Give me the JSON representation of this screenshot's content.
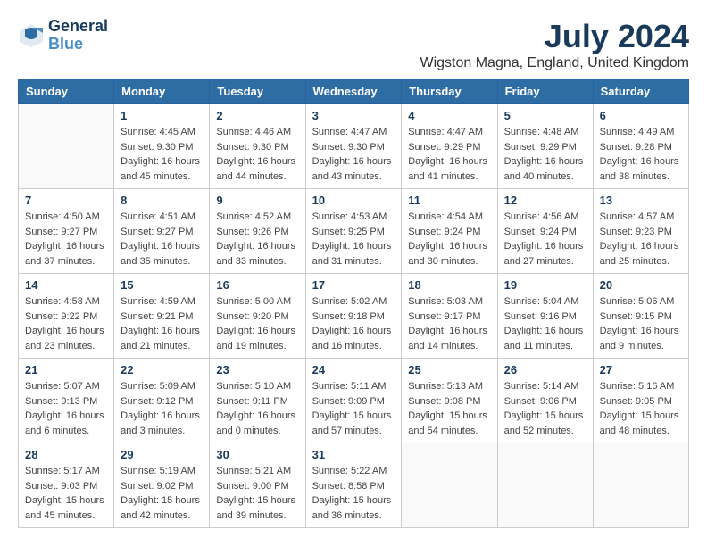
{
  "logo": {
    "line1": "General",
    "line2": "Blue"
  },
  "title": "July 2024",
  "location": "Wigston Magna, England, United Kingdom",
  "weekdays": [
    "Sunday",
    "Monday",
    "Tuesday",
    "Wednesday",
    "Thursday",
    "Friday",
    "Saturday"
  ],
  "weeks": [
    [
      {
        "day": "",
        "info": ""
      },
      {
        "day": "1",
        "info": "Sunrise: 4:45 AM\nSunset: 9:30 PM\nDaylight: 16 hours\nand 45 minutes."
      },
      {
        "day": "2",
        "info": "Sunrise: 4:46 AM\nSunset: 9:30 PM\nDaylight: 16 hours\nand 44 minutes."
      },
      {
        "day": "3",
        "info": "Sunrise: 4:47 AM\nSunset: 9:30 PM\nDaylight: 16 hours\nand 43 minutes."
      },
      {
        "day": "4",
        "info": "Sunrise: 4:47 AM\nSunset: 9:29 PM\nDaylight: 16 hours\nand 41 minutes."
      },
      {
        "day": "5",
        "info": "Sunrise: 4:48 AM\nSunset: 9:29 PM\nDaylight: 16 hours\nand 40 minutes."
      },
      {
        "day": "6",
        "info": "Sunrise: 4:49 AM\nSunset: 9:28 PM\nDaylight: 16 hours\nand 38 minutes."
      }
    ],
    [
      {
        "day": "7",
        "info": "Sunrise: 4:50 AM\nSunset: 9:27 PM\nDaylight: 16 hours\nand 37 minutes."
      },
      {
        "day": "8",
        "info": "Sunrise: 4:51 AM\nSunset: 9:27 PM\nDaylight: 16 hours\nand 35 minutes."
      },
      {
        "day": "9",
        "info": "Sunrise: 4:52 AM\nSunset: 9:26 PM\nDaylight: 16 hours\nand 33 minutes."
      },
      {
        "day": "10",
        "info": "Sunrise: 4:53 AM\nSunset: 9:25 PM\nDaylight: 16 hours\nand 31 minutes."
      },
      {
        "day": "11",
        "info": "Sunrise: 4:54 AM\nSunset: 9:24 PM\nDaylight: 16 hours\nand 30 minutes."
      },
      {
        "day": "12",
        "info": "Sunrise: 4:56 AM\nSunset: 9:24 PM\nDaylight: 16 hours\nand 27 minutes."
      },
      {
        "day": "13",
        "info": "Sunrise: 4:57 AM\nSunset: 9:23 PM\nDaylight: 16 hours\nand 25 minutes."
      }
    ],
    [
      {
        "day": "14",
        "info": "Sunrise: 4:58 AM\nSunset: 9:22 PM\nDaylight: 16 hours\nand 23 minutes."
      },
      {
        "day": "15",
        "info": "Sunrise: 4:59 AM\nSunset: 9:21 PM\nDaylight: 16 hours\nand 21 minutes."
      },
      {
        "day": "16",
        "info": "Sunrise: 5:00 AM\nSunset: 9:20 PM\nDaylight: 16 hours\nand 19 minutes."
      },
      {
        "day": "17",
        "info": "Sunrise: 5:02 AM\nSunset: 9:18 PM\nDaylight: 16 hours\nand 16 minutes."
      },
      {
        "day": "18",
        "info": "Sunrise: 5:03 AM\nSunset: 9:17 PM\nDaylight: 16 hours\nand 14 minutes."
      },
      {
        "day": "19",
        "info": "Sunrise: 5:04 AM\nSunset: 9:16 PM\nDaylight: 16 hours\nand 11 minutes."
      },
      {
        "day": "20",
        "info": "Sunrise: 5:06 AM\nSunset: 9:15 PM\nDaylight: 16 hours\nand 9 minutes."
      }
    ],
    [
      {
        "day": "21",
        "info": "Sunrise: 5:07 AM\nSunset: 9:13 PM\nDaylight: 16 hours\nand 6 minutes."
      },
      {
        "day": "22",
        "info": "Sunrise: 5:09 AM\nSunset: 9:12 PM\nDaylight: 16 hours\nand 3 minutes."
      },
      {
        "day": "23",
        "info": "Sunrise: 5:10 AM\nSunset: 9:11 PM\nDaylight: 16 hours\nand 0 minutes."
      },
      {
        "day": "24",
        "info": "Sunrise: 5:11 AM\nSunset: 9:09 PM\nDaylight: 15 hours\nand 57 minutes."
      },
      {
        "day": "25",
        "info": "Sunrise: 5:13 AM\nSunset: 9:08 PM\nDaylight: 15 hours\nand 54 minutes."
      },
      {
        "day": "26",
        "info": "Sunrise: 5:14 AM\nSunset: 9:06 PM\nDaylight: 15 hours\nand 52 minutes."
      },
      {
        "day": "27",
        "info": "Sunrise: 5:16 AM\nSunset: 9:05 PM\nDaylight: 15 hours\nand 48 minutes."
      }
    ],
    [
      {
        "day": "28",
        "info": "Sunrise: 5:17 AM\nSunset: 9:03 PM\nDaylight: 15 hours\nand 45 minutes."
      },
      {
        "day": "29",
        "info": "Sunrise: 5:19 AM\nSunset: 9:02 PM\nDaylight: 15 hours\nand 42 minutes."
      },
      {
        "day": "30",
        "info": "Sunrise: 5:21 AM\nSunset: 9:00 PM\nDaylight: 15 hours\nand 39 minutes."
      },
      {
        "day": "31",
        "info": "Sunrise: 5:22 AM\nSunset: 8:58 PM\nDaylight: 15 hours\nand 36 minutes."
      },
      {
        "day": "",
        "info": ""
      },
      {
        "day": "",
        "info": ""
      },
      {
        "day": "",
        "info": ""
      }
    ]
  ]
}
